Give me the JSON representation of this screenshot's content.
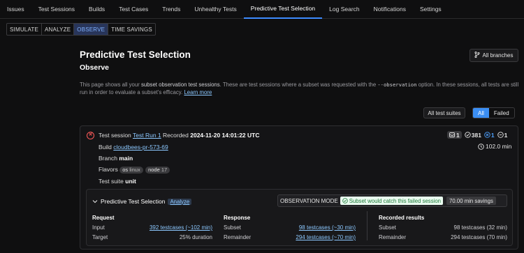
{
  "nav": {
    "tabs": [
      "Issues",
      "Test Sessions",
      "Builds",
      "Test Cases",
      "Trends",
      "Unhealthy Tests",
      "Predictive Test Selection",
      "Log Search",
      "Notifications",
      "Settings"
    ],
    "active": "Predictive Test Selection"
  },
  "subtabs": {
    "items": [
      "SIMULATE",
      "ANALYZE",
      "OBSERVE",
      "TIME SAVINGS"
    ],
    "active": "OBSERVE"
  },
  "header": {
    "title": "Predictive Test Selection",
    "subtitle": "Observe",
    "branches_button": "All branches"
  },
  "description": {
    "part1": "This page shows all your ",
    "bold1": "subset observation test sessions",
    "part2": ". These are test sessions where a subset was requested with the ",
    "code": "--observation",
    "part3": " option. In these sessions, all tests are still run in order to evaluate a subset's efficacy. ",
    "link": "Learn more"
  },
  "filters": {
    "suites_button": "All test suites",
    "status": [
      "All",
      "Failed"
    ],
    "active_status": "All"
  },
  "session": {
    "label": "Test session",
    "name": "Test Run 1",
    "recorded_label": "Recorded",
    "recorded": "2024-11-20 14:01:22 UTC",
    "build_label": "Build",
    "build": "cloudbees-pr-573-69",
    "branch_label": "Branch",
    "branch": "main",
    "flavors_label": "Flavors",
    "flavors": [
      {
        "k": "os",
        "v": "linux"
      },
      {
        "k": "node",
        "v": "17"
      }
    ],
    "suite_label": "Test suite",
    "suite": "unit",
    "stats": {
      "messages": "1",
      "passed": "381",
      "failed": "1",
      "skipped": "1"
    },
    "duration": "102.0 min"
  },
  "pts": {
    "title": "Predictive Test Selection",
    "analyze": "Analyze",
    "mode_label": "OBSERVATION MODE",
    "catch_text": "Subset would catch this failed session",
    "savings": "70.00 min savings",
    "request": {
      "heading": "Request",
      "input_label": "Input",
      "input": "392 testcases (~102 min)",
      "target_label": "Target",
      "target": "25% duration"
    },
    "response": {
      "heading": "Response",
      "subset_label": "Subset",
      "subset": "98 testcases (~30 min)",
      "remainder_label": "Remainder",
      "remainder": "294 testcases (~70 min)"
    },
    "recorded": {
      "heading": "Recorded results",
      "subset_label": "Subset",
      "subset": "98 testcases (32 min)",
      "remainder_label": "Remainder",
      "remainder": "294 testcases (70 min)"
    }
  },
  "colors": {
    "accent": "#3b8ef3",
    "fail": "#ff5a5a",
    "link": "#8cc8ff",
    "success_bg": "#e9fbef"
  }
}
